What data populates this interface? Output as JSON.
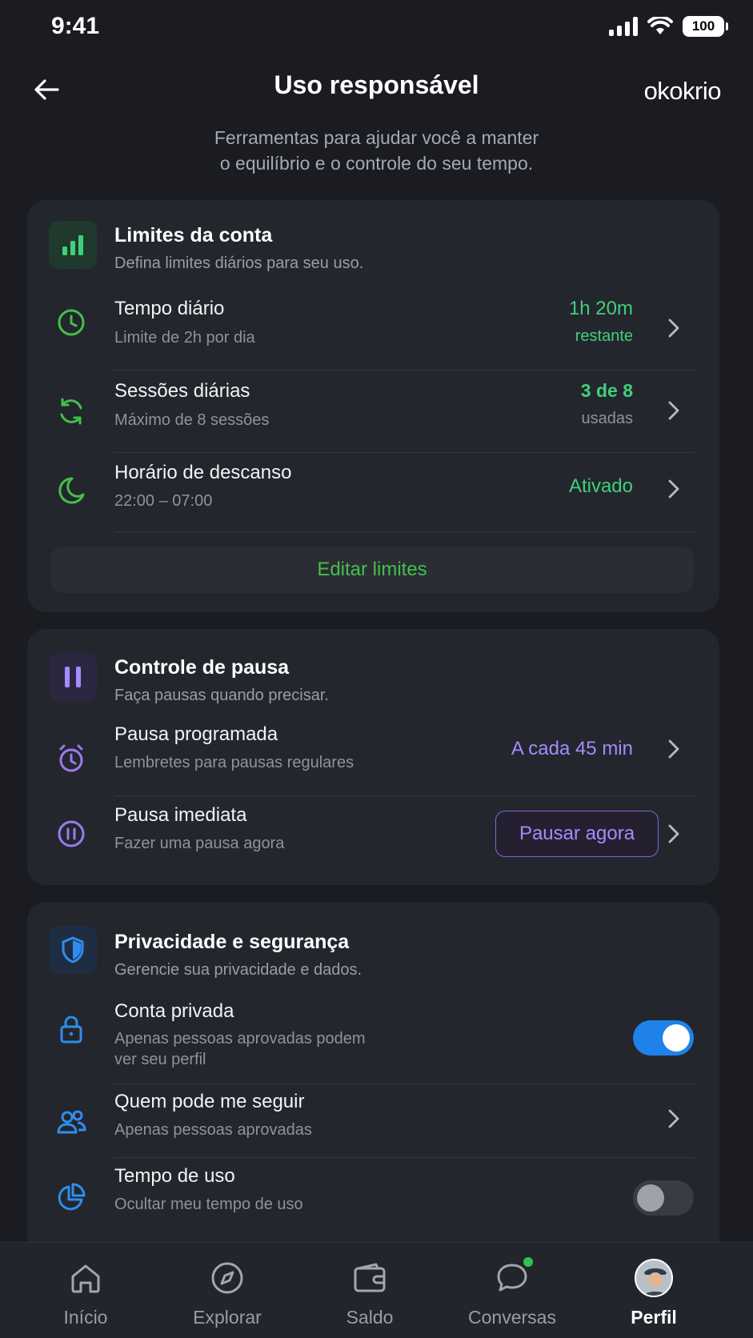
{
  "status_bar": {
    "time": "9:41",
    "battery": "100"
  },
  "header": {
    "title": "Uso responsável",
    "brand": "okokrio",
    "subtitle_line1": "Ferramentas para ajudar você a manter",
    "subtitle_line2": "o equilíbrio e o controle do seu tempo."
  },
  "limits": {
    "title": "Limites da conta",
    "description": "Defina limites diários para seu uso.",
    "rows": [
      {
        "icon": "clock-icon",
        "title": "Tempo diário",
        "subtitle": "Limite de 2h por dia",
        "value": "1h 20m",
        "value_sub": "restante"
      },
      {
        "icon": "refresh-icon",
        "title": "Sessões diárias",
        "subtitle": "Máximo de 8 sessões",
        "value": "3 de 8",
        "value_sub": "usadas"
      },
      {
        "icon": "moon-icon",
        "title": "Horário de descanso",
        "subtitle": "22:00 – 07:00",
        "value": "Ativado"
      }
    ],
    "edit_button": "Editar limites"
  },
  "pause": {
    "title": "Controle de pausa",
    "description": "Faça pausas quando precisar.",
    "rows": [
      {
        "icon": "stopwatch-icon",
        "title": "Pausa programada",
        "subtitle": "Lembretes para pausas regulares",
        "value": "A cada 45 min"
      },
      {
        "icon": "pause-circle-icon",
        "title": "Pausa imediata",
        "subtitle": "Fazer uma pausa agora",
        "button": "Pausar agora"
      }
    ]
  },
  "privacy": {
    "title": "Privacidade e segurança",
    "description": "Gerencie sua privacidade e dados.",
    "rows": [
      {
        "icon": "lock-icon",
        "title": "Conta privada",
        "subtitle_line1": "Apenas pessoas aprovadas podem",
        "subtitle_line2": "ver seu perfil",
        "toggle": true
      },
      {
        "icon": "users-icon",
        "title": "Quem pode me seguir",
        "subtitle": "Apenas pessoas aprovadas"
      },
      {
        "icon": "pie-chart-icon",
        "title": "Tempo de uso",
        "subtitle": "Ocultar meu tempo de uso",
        "toggle": false
      }
    ]
  },
  "nav": {
    "items": [
      {
        "icon": "home-icon",
        "label": "Início"
      },
      {
        "icon": "compass-icon",
        "label": "Explorar"
      },
      {
        "icon": "wallet-icon",
        "label": "Saldo"
      },
      {
        "icon": "chat-icon",
        "label": "Conversas"
      },
      {
        "icon": "avatar",
        "label": "Perfil",
        "active": true
      }
    ]
  },
  "colors": {
    "green": "#44c04a",
    "value_green": "#3fd07a",
    "purple": "#a48bff",
    "blue": "#1e82e8"
  }
}
